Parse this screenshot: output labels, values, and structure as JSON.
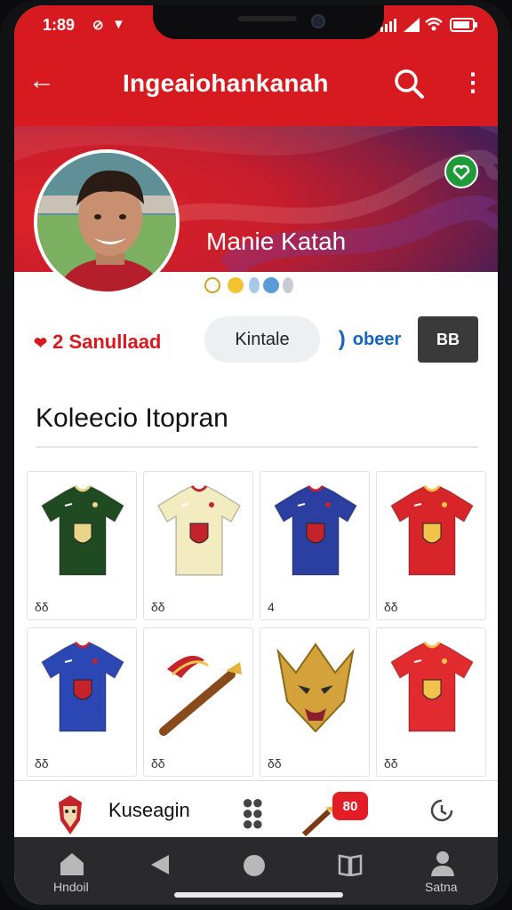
{
  "status": {
    "time": "1:89"
  },
  "appbar": {
    "title": "Ingeaiohankanah"
  },
  "profile": {
    "name": "Manie Katah"
  },
  "stats": {
    "followers": "2 Sanullaad"
  },
  "actions": {
    "btn1": "Kintale",
    "btn2": "obeer",
    "btn3": "BB"
  },
  "section": {
    "title": "Koleecio Itopran"
  },
  "collection": [
    {
      "name": "Dark green jersey",
      "label": "δδ",
      "kind": "jersey",
      "color": "#1f4a22",
      "trim": "#e8d58a"
    },
    {
      "name": "Cream jersey",
      "label": "δδ",
      "kind": "jersey",
      "color": "#f2ecc0",
      "trim": "#c4232b"
    },
    {
      "name": "Blue jersey",
      "label": "4",
      "kind": "jersey",
      "color": "#2a3f9f",
      "trim": "#c4232b"
    },
    {
      "name": "Red jersey",
      "label": "δδ",
      "kind": "jersey",
      "color": "#d7252a",
      "trim": "#f2c24a"
    },
    {
      "name": "Blue red jersey",
      "label": "δδ",
      "kind": "jersey",
      "color": "#2b47b3",
      "trim": "#c4232b"
    },
    {
      "name": "Trumpet scarf",
      "label": "δδ",
      "kind": "horn",
      "color": "#8a4b1c",
      "trim": "#c4232b"
    },
    {
      "name": "Gold mask",
      "label": "δδ",
      "kind": "mask",
      "color": "#d3a23a",
      "trim": "#8a1f2a"
    },
    {
      "name": "Red jersey 2",
      "label": "δδ",
      "kind": "jersey",
      "color": "#e12b2f",
      "trim": "#f2c24a"
    }
  ],
  "bottom_panel": {
    "label": "Kuseagin",
    "badge": "80"
  },
  "nav": {
    "home": "Hndoil",
    "profile": "Satna"
  },
  "colors": {
    "brand": "#d71a1f",
    "verify": "#1e9a3a"
  }
}
